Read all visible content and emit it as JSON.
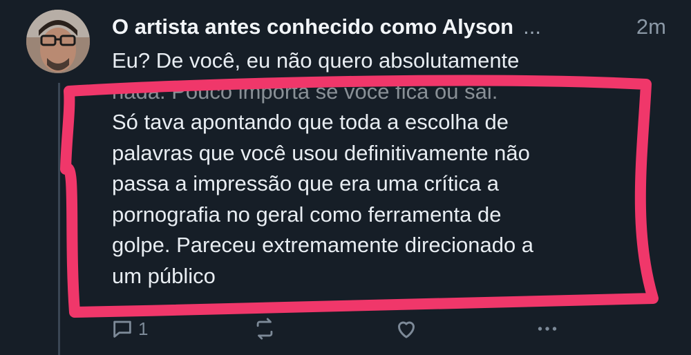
{
  "post": {
    "author": "O artista antes conhecido como Alyson",
    "more": "...",
    "timestamp": "2m",
    "lines": [
      "Eu? De você, eu não quero absolutamente",
      "nada. Pouco importa se você fica ou sai.",
      "Só tava apontando que toda a escolha de",
      "palavras que você usou definitivamente não",
      "passa a impressão que era uma crítica a",
      "pornografia no geral como ferramenta de",
      "golpe. Pareceu extremamente direcionado a",
      "um público"
    ]
  },
  "actions": {
    "reply_icon": "reply-icon",
    "reply_count": "1",
    "repost_icon": "repost-icon",
    "like_icon": "heart-icon",
    "more_icon": "more-options-icon"
  },
  "colors": {
    "background": "#161e27",
    "text": "#e8edf2",
    "muted": "#8b98a6",
    "highlight_stroke": "#f0376a"
  }
}
